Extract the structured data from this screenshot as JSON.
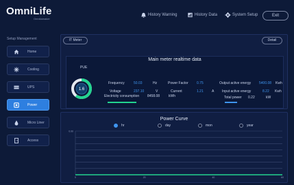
{
  "header": {
    "logo": "OmniLife",
    "logo_sub": "Omnilamaker",
    "nav": [
      {
        "label": "History Warning",
        "icon": "alarm-icon"
      },
      {
        "label": "History Data",
        "icon": "data-icon"
      },
      {
        "label": "System Setup",
        "icon": "gear-icon"
      }
    ],
    "exit_label": "Exit"
  },
  "sidebar": {
    "title": "Setup Management",
    "items": [
      {
        "label": "Home",
        "icon": "home-icon",
        "active": false
      },
      {
        "label": "Cooling",
        "icon": "cooling-icon",
        "active": false
      },
      {
        "label": "UPS",
        "icon": "ups-icon",
        "active": false
      },
      {
        "label": "Power",
        "icon": "power-icon",
        "active": true
      },
      {
        "label": "Micro Liner",
        "icon": "drop-icon",
        "active": false
      },
      {
        "label": "Access",
        "icon": "door-icon",
        "active": false
      }
    ]
  },
  "meter": {
    "tab_label": "IT Meter",
    "detail_label": "Detail",
    "title": "Main meter realtime data",
    "pue_label": "PUE",
    "pue_value": "1.6",
    "pue_fraction": 0.6,
    "readings": {
      "voltage": {
        "label": "Voltage",
        "value": "237.10",
        "unit": "V"
      },
      "current": {
        "label": "Current",
        "value": "1.21",
        "unit": "A"
      },
      "input_energy": {
        "label": "Input active energy",
        "value": "8.22",
        "unit": "Kwh"
      },
      "frequency": {
        "label": "Frequency",
        "value": "50.03",
        "unit": "Hz"
      },
      "power_factor": {
        "label": "Power Factor",
        "value": "0.75",
        "unit": ""
      },
      "output_energy": {
        "label": "Output active energy",
        "value": "5400.08",
        "unit": "Kwh"
      },
      "consumption": {
        "label": "Electricity consumption",
        "value": "8458.08",
        "unit": "kWh"
      },
      "total_power": {
        "label": "Total power",
        "value": "0.22",
        "unit": "kW"
      }
    }
  },
  "curve": {
    "title": "Power Curve",
    "options": [
      {
        "label": "hr",
        "selected": true
      },
      {
        "label": "day",
        "selected": false
      },
      {
        "label": "mon",
        "selected": false
      },
      {
        "label": "year",
        "selected": false
      }
    ]
  },
  "chart_data": {
    "type": "line",
    "title": "Power Curve",
    "y_ticks": [
      "0.00",
      "",
      "",
      "",
      "",
      "",
      "",
      ""
    ],
    "x_ticks": [
      "0",
      "20",
      "40",
      "60"
    ],
    "xlim": [
      0,
      60
    ],
    "series": [
      {
        "color": "#22d490",
        "x": [
          0,
          60
        ],
        "y": [
          0,
          0
        ]
      }
    ],
    "grid": true
  }
}
